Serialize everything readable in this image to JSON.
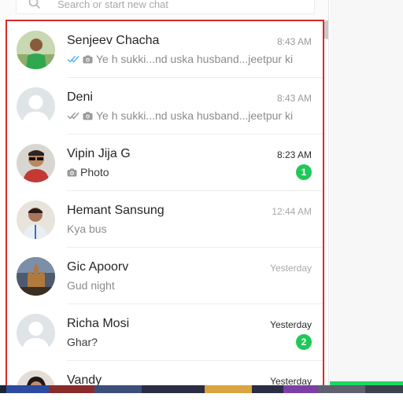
{
  "search": {
    "placeholder": "Search or start new chat"
  },
  "colors": {
    "accent_green": "#20c85a",
    "highlight_border": "#d62a2a",
    "read_tick": "#4fb6ec",
    "delivered_tick": "#9a9a9a"
  },
  "chats": [
    {
      "name": "Senjeev Chacha",
      "time": "8:43 AM",
      "preview": "Ye h sukki...nd uska husband...jeetpur ki",
      "tick": "read",
      "has_camera": true,
      "avatar": "photo-boy-green"
    },
    {
      "name": "Deni",
      "time": "8:43 AM",
      "preview": "Ye h sukki...nd uska husband...jeetpur ki",
      "tick": "delivered",
      "has_camera": true,
      "avatar": "default"
    },
    {
      "name": "Vipin Jija G",
      "time": "8:23 AM",
      "preview": "Photo",
      "tick": "none",
      "has_camera": true,
      "unread": "1",
      "avatar": "photo-sunglasses"
    },
    {
      "name": "Hemant Sansung",
      "time": "12:44 AM",
      "preview": "Kya bus",
      "tick": "none",
      "has_camera": false,
      "avatar": "photo-man-lanyard"
    },
    {
      "name": "Gic Apoorv",
      "time": "Yesterday",
      "preview": "Gud night",
      "tick": "none",
      "has_camera": false,
      "avatar": "photo-temple"
    },
    {
      "name": "Richa Mosi",
      "time": "Yesterday",
      "preview": "Ghar?",
      "tick": "none",
      "has_camera": false,
      "unread": "2",
      "avatar": "default"
    },
    {
      "name": "Vandy",
      "time": "Yesterday",
      "preview": "",
      "tick": "none",
      "has_camera": false,
      "avatar": "photo-woman"
    }
  ]
}
